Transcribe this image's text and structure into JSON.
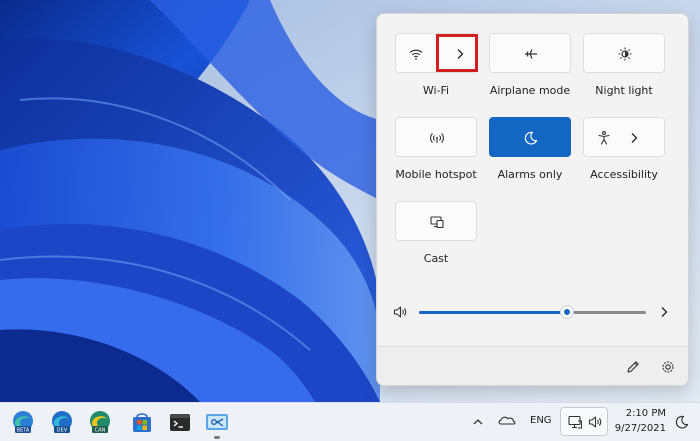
{
  "quick_settings": {
    "tiles": [
      {
        "label": "Wi-Fi",
        "icon": "wifi-icon",
        "state": "off"
      },
      {
        "label": "Airplane mode",
        "icon": "airplane-icon",
        "state": "off"
      },
      {
        "label": "Night light",
        "icon": "night-light-icon",
        "state": "off"
      },
      {
        "label": "Mobile hotspot",
        "icon": "mobile-hotspot-icon",
        "state": "off"
      },
      {
        "label": "Alarms only",
        "icon": "moon-icon",
        "state": "on"
      },
      {
        "label": "Accessibility",
        "icon": "accessibility-icon",
        "state": "off"
      },
      {
        "label": "Cast",
        "icon": "cast-icon",
        "state": "off"
      }
    ],
    "volume": {
      "level": 0.65,
      "icon": "speaker-icon"
    },
    "footer": {
      "edit_icon": "pencil-icon",
      "settings_icon": "gear-icon"
    }
  },
  "taskbar": {
    "apps": [
      {
        "name": "edge-beta",
        "badge": "BETA"
      },
      {
        "name": "edge-dev",
        "badge": "DEV"
      },
      {
        "name": "edge-canary",
        "badge": "CAN"
      },
      {
        "name": "microsoft-store"
      },
      {
        "name": "terminal"
      },
      {
        "name": "snipping-tool"
      }
    ],
    "tray": {
      "language": "ENG",
      "time": "2:10 PM",
      "date": "9/27/2021"
    }
  },
  "colors": {
    "accent": "#1366c2",
    "highlight_box": "#d21f1f"
  }
}
